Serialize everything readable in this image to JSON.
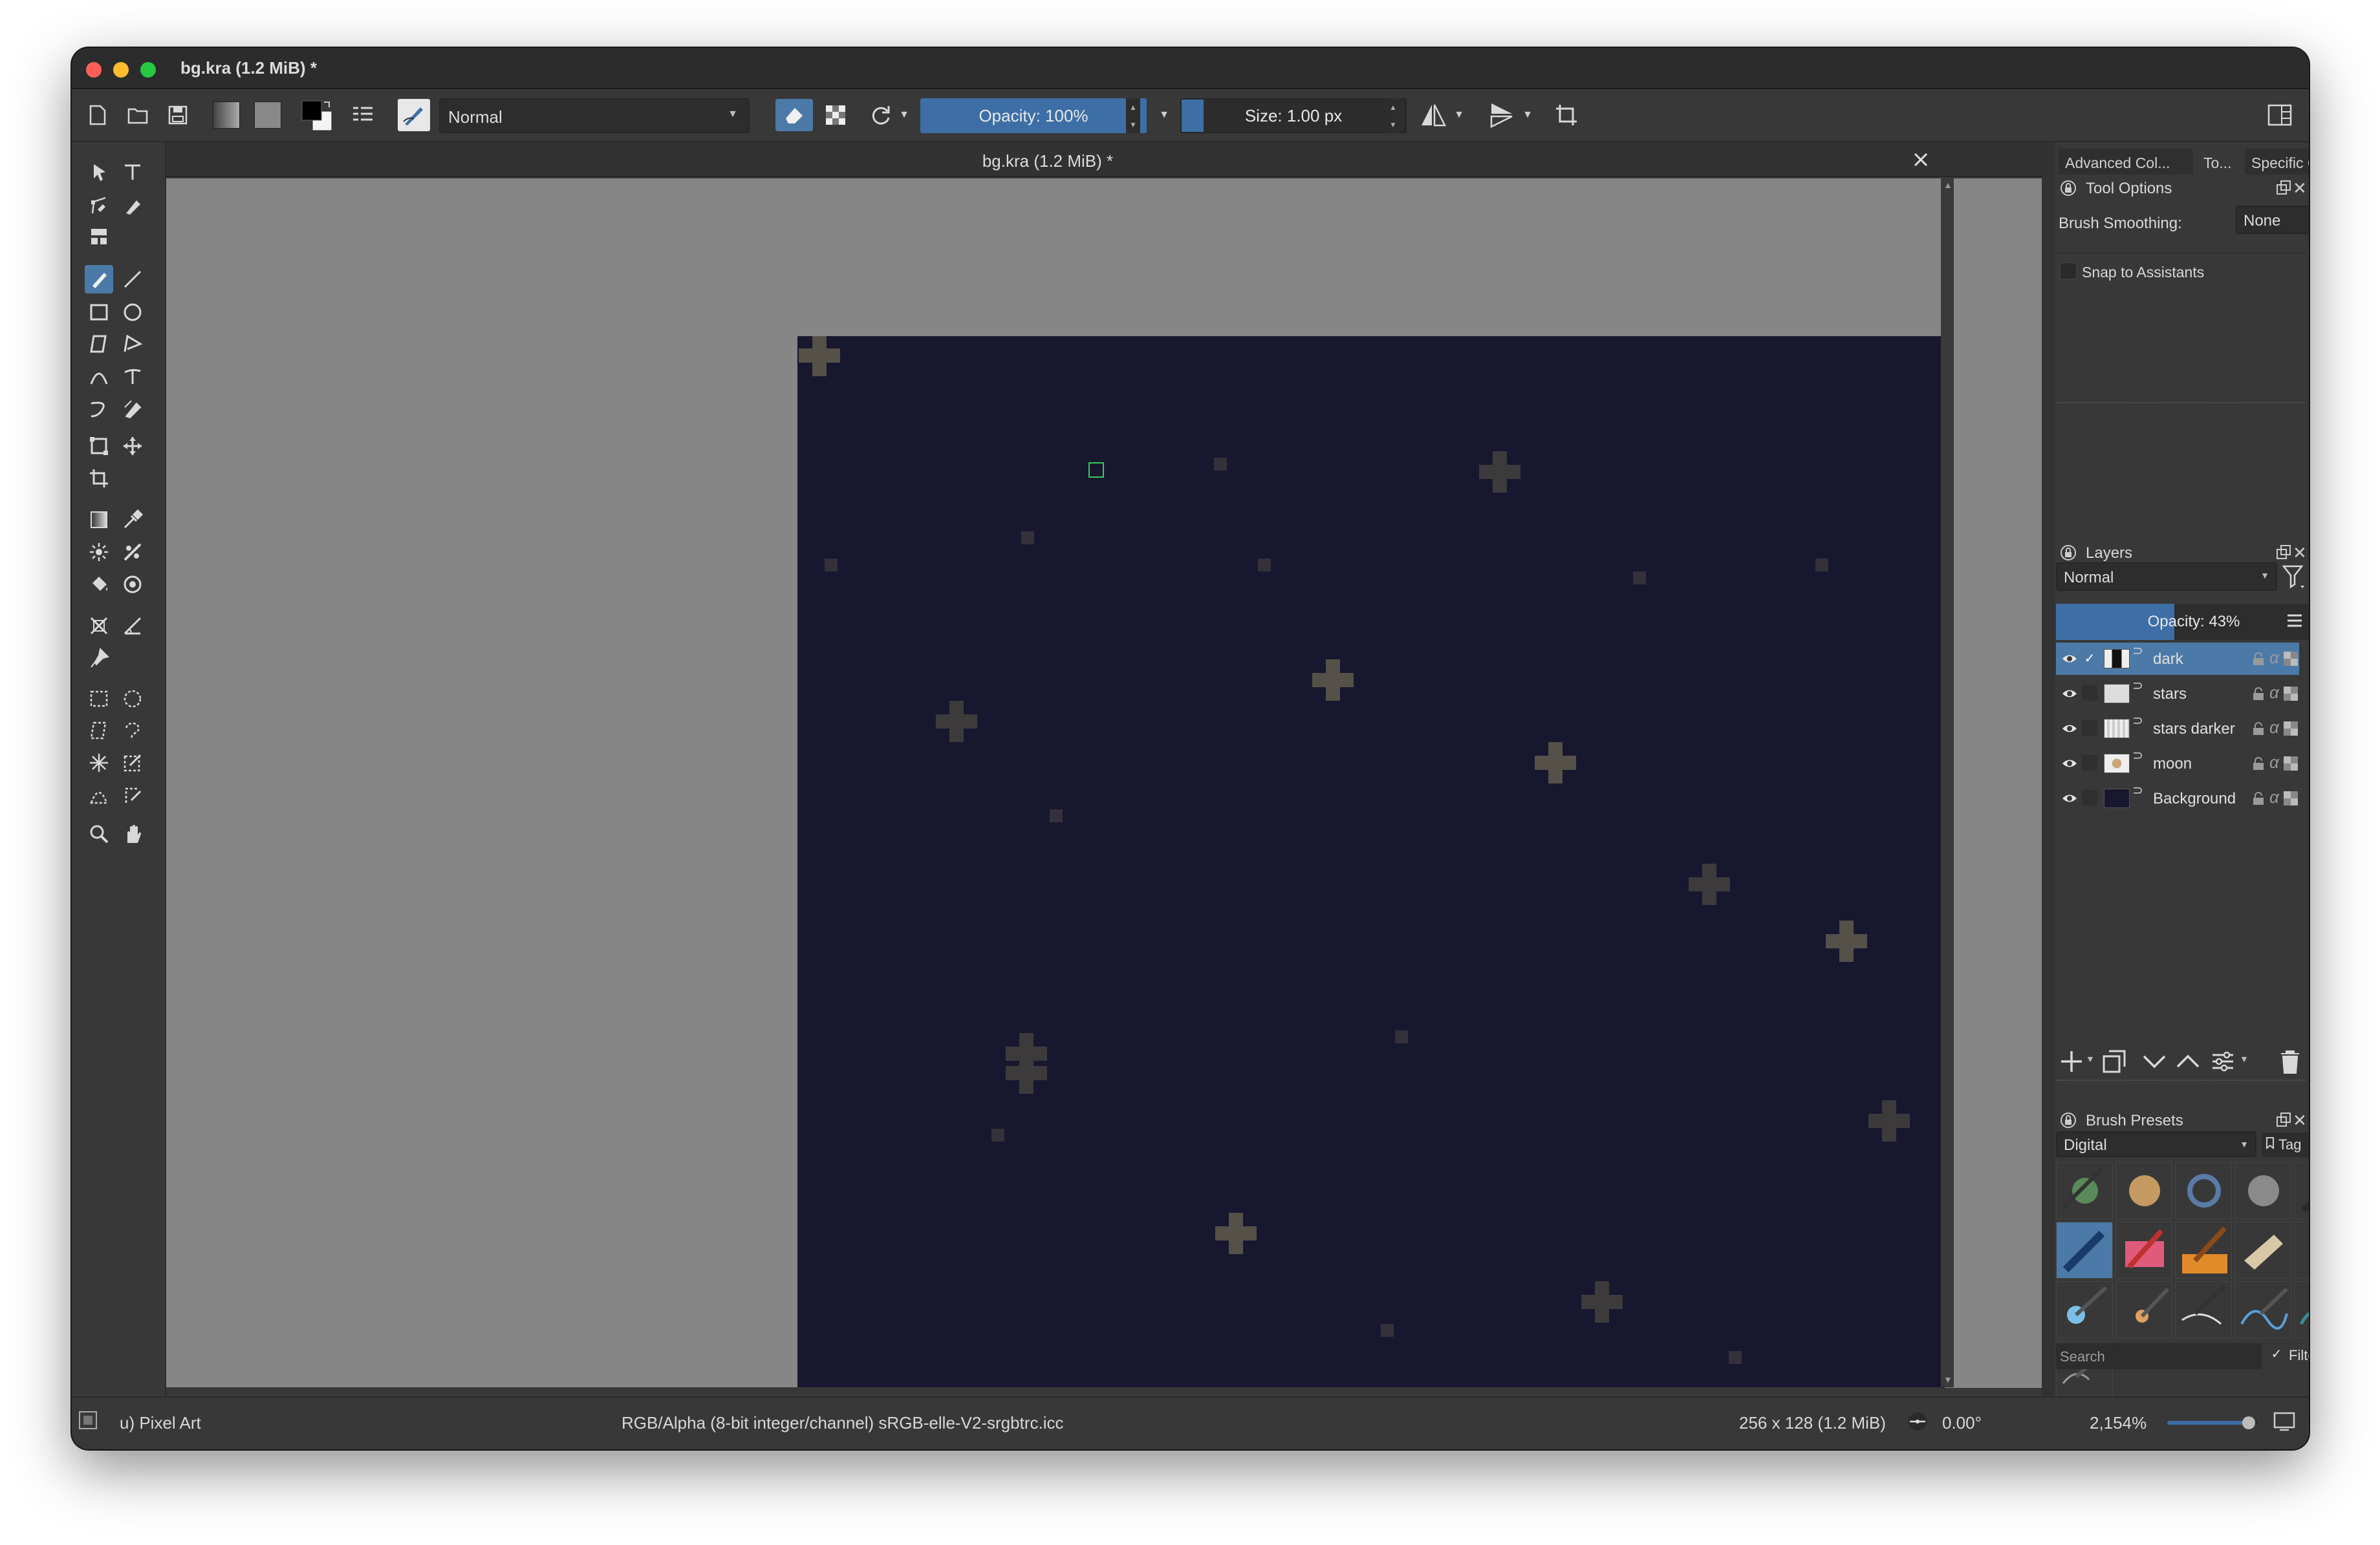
{
  "window": {
    "title": "bg.kra (1.2 MiB) *"
  },
  "toolbar": {
    "blend_mode": "Normal",
    "opacity_label": "Opacity: 100%",
    "opacity_value": 1.0,
    "size_label": "Size: 1.00 px"
  },
  "document": {
    "tab_title": "bg.kra (1.2 MiB) *"
  },
  "dock_tabs": [
    "Advanced Col...",
    "To...",
    "Specific Col..."
  ],
  "tool_options": {
    "title": "Tool Options",
    "brush_smoothing_label": "Brush Smoothing:",
    "brush_smoothing_value": "None",
    "snap_label": "Snap to Assistants",
    "snap_checked": false
  },
  "layers": {
    "title": "Layers",
    "blend_mode": "Normal",
    "opacity_label": "Opacity: 43%",
    "opacity_value": 0.43,
    "items": [
      {
        "name": "dark",
        "visible": true,
        "selected": true
      },
      {
        "name": "stars",
        "visible": true,
        "selected": false
      },
      {
        "name": "stars darker",
        "visible": true,
        "selected": false
      },
      {
        "name": "moon",
        "visible": true,
        "selected": false
      },
      {
        "name": "Background",
        "visible": true,
        "selected": false
      }
    ]
  },
  "brush_presets": {
    "title": "Brush Presets",
    "tag": "Digital",
    "tag_button": "Tag",
    "search_placeholder": "Search",
    "filter_label": "Filter in Tag",
    "filter_checked": true
  },
  "status": {
    "preset": "u) Pixel Art",
    "color_info": "RGB/Alpha (8-bit integer/channel)  sRGB-elle-V2-srgbtrc.icc",
    "image_size": "256 x 128 (1.2 MiB)",
    "rotation": "0.00°",
    "zoom": "2,154%"
  },
  "colors": {
    "accent": "#4c7aa8",
    "slider_fill": "#3d6fa6",
    "canvas_bg": "#868686",
    "night_sky": "#181730",
    "star": "#555048"
  }
}
